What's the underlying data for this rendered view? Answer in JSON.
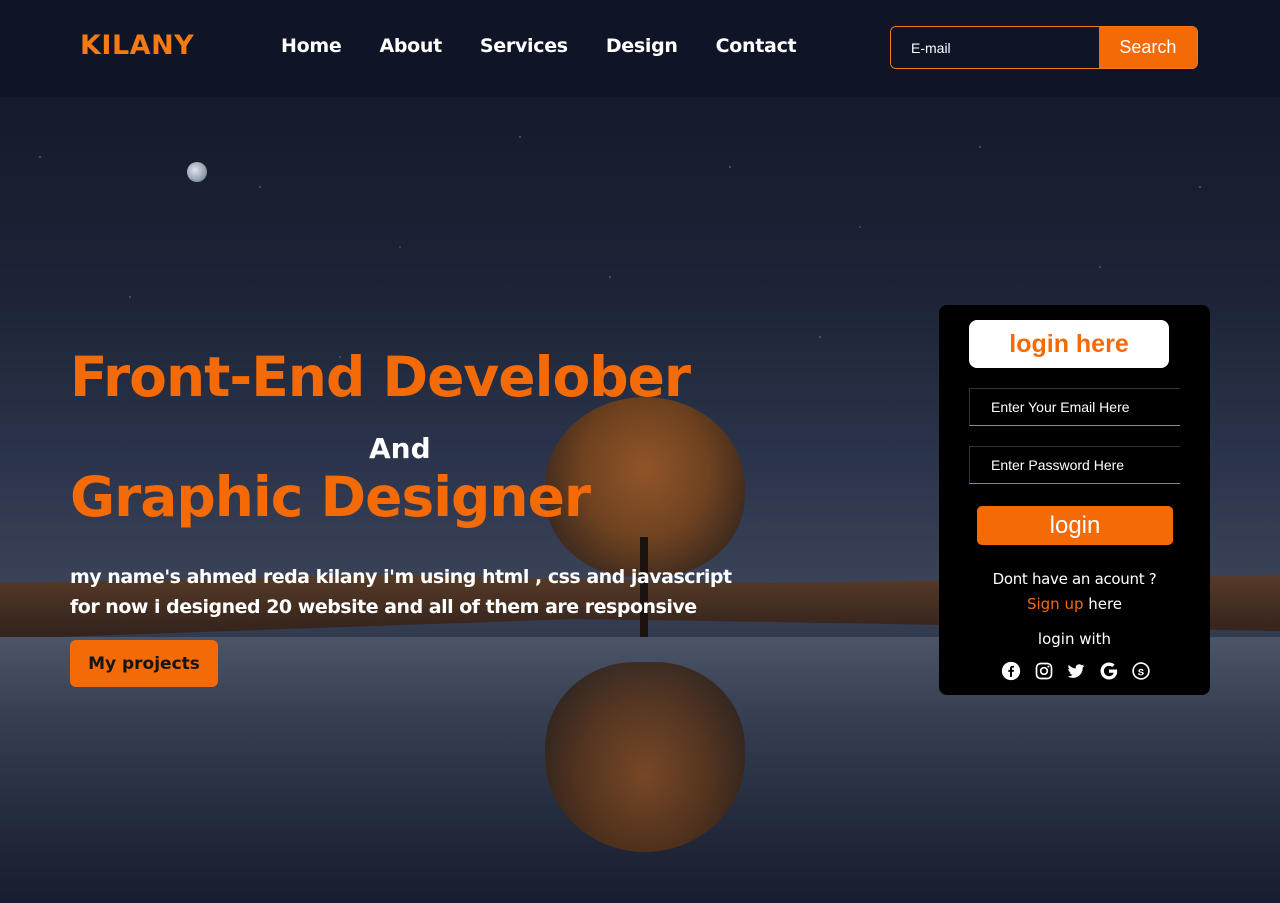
{
  "header": {
    "logo": "KILANY",
    "nav": [
      "Home",
      "About",
      "Services",
      "Design",
      "Contact"
    ],
    "search": {
      "placeholder": "E-mail",
      "button_label": "Search"
    }
  },
  "hero": {
    "title_line1": "Front-End Develober",
    "title_and": "And",
    "title_line2": "Graphic Designer",
    "description_line1": "my name's ahmed reda kilany i'm using html , css and javascript",
    "description_line2": "for now i designed 20 website and all of them are responsive",
    "projects_button": "My projects"
  },
  "login": {
    "title": "login here",
    "email_placeholder": "Enter Your Email Here",
    "password_placeholder": "Enter Password Here",
    "button_label": "login",
    "no_account_text": "Dont have an acount ?",
    "signup_link": "Sign up",
    "signup_suffix": " here",
    "login_with": "login with",
    "social_icons": [
      "facebook-icon",
      "instagram-icon",
      "twitter-icon",
      "google-icon",
      "skype-icon"
    ]
  },
  "colors": {
    "accent": "#f46a07",
    "header_bg": "#0f1426",
    "card_bg": "#000000"
  }
}
